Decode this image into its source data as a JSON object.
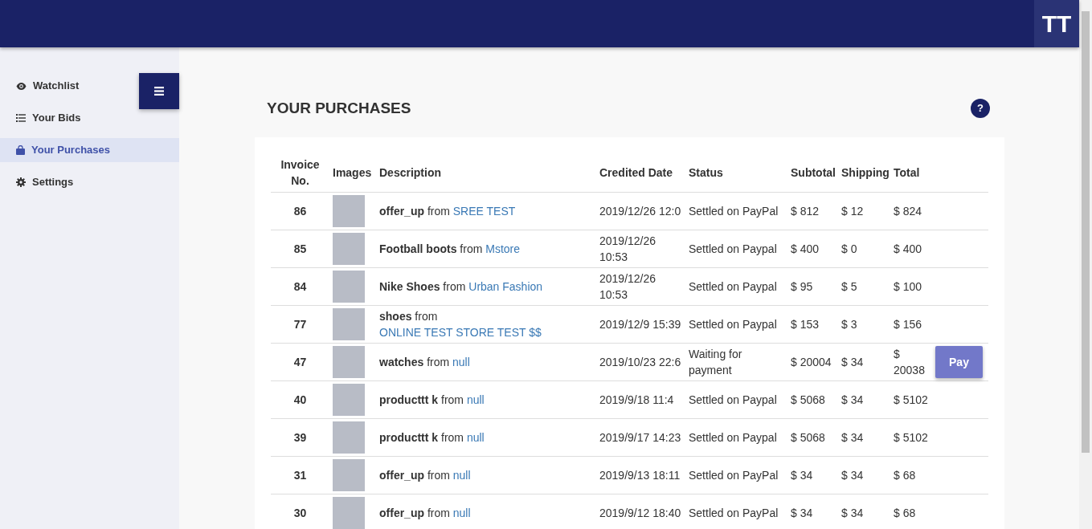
{
  "header": {
    "avatar": "TT"
  },
  "sidebar": {
    "items": [
      {
        "label": "Watchlist",
        "selected": false
      },
      {
        "label": "Your Bids",
        "selected": false
      },
      {
        "label": "Your Purchases",
        "selected": true
      },
      {
        "label": "Settings",
        "selected": false
      }
    ]
  },
  "page": {
    "title": "YOUR PURCHASES",
    "help": "?"
  },
  "table": {
    "columns": [
      "Invoice No.",
      "Images",
      "Description",
      "Credited Date",
      "Status",
      "Subtotal",
      "Shipping",
      "Total"
    ],
    "rows": [
      {
        "invoice": "86",
        "name": "offer_up",
        "from": "from",
        "store": "SREE TEST",
        "date": "2019/12/26 12:0",
        "status": "Settled on PayPal",
        "subtotal": "$ 812",
        "shipping": "$ 12",
        "total": "$ 824"
      },
      {
        "invoice": "85",
        "name": "Football boots",
        "from": "from",
        "store": "Mstore",
        "date": "2019/12/26 10:53",
        "status": "Settled on Paypal",
        "subtotal": "$ 400",
        "shipping": "$ 0",
        "total": "$ 400"
      },
      {
        "invoice": "84",
        "name": "Nike Shoes",
        "from": "from",
        "store": "Urban Fashion",
        "date": "2019/12/26 10:53",
        "status": "Settled on Paypal",
        "subtotal": "$ 95",
        "shipping": "$ 5",
        "total": "$ 100"
      },
      {
        "invoice": "77",
        "name": "shoes",
        "from": "from",
        "store": "ONLINE TEST STORE TEST $$",
        "date": "2019/12/9 15:39",
        "status": "Settled on Paypal",
        "subtotal": "$ 153",
        "shipping": "$ 3",
        "total": "$ 156"
      },
      {
        "invoice": "47",
        "name": "watches",
        "from": "from",
        "store": "null",
        "date": "2019/10/23 22:6",
        "status": "Waiting for payment",
        "subtotal": "$ 20004",
        "shipping": "$ 34",
        "total": "$ 20038",
        "action": "Pay"
      },
      {
        "invoice": "40",
        "name": "producttt k",
        "from": "from",
        "store": "null",
        "date": "2019/9/18 11:4",
        "status": "Settled on Paypal",
        "subtotal": "$ 5068",
        "shipping": "$ 34",
        "total": "$ 5102"
      },
      {
        "invoice": "39",
        "name": "producttt k",
        "from": "from",
        "store": "null",
        "date": "2019/9/17 14:23",
        "status": "Settled on Paypal",
        "subtotal": "$ 5068",
        "shipping": "$ 34",
        "total": "$ 5102"
      },
      {
        "invoice": "31",
        "name": "offer_up",
        "from": "from",
        "store": "null",
        "date": "2019/9/13 18:11",
        "status": "Settled on PayPal",
        "subtotal": "$ 34",
        "shipping": "$ 34",
        "total": "$ 68"
      },
      {
        "invoice": "30",
        "name": "offer_up",
        "from": "from",
        "store": "null",
        "date": "2019/9/12 18:40",
        "status": "Settled on PayPal",
        "subtotal": "$ 34",
        "shipping": "$ 34",
        "total": "$ 68"
      }
    ]
  }
}
